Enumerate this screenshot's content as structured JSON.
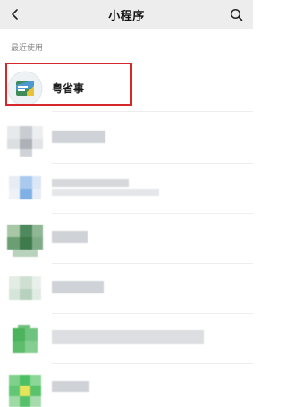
{
  "header": {
    "title": "小程序",
    "back_icon": "chevron-left-icon",
    "search_icon": "search-icon"
  },
  "recent": {
    "section_label": "最近使用",
    "items": [
      {
        "label": "粤省事",
        "icon": "yue-sheng-shi-logo"
      },
      {
        "label": "",
        "icon": "pixelated-app-icon"
      },
      {
        "label": "",
        "icon": "pixelated-app-icon"
      },
      {
        "label": "",
        "icon": "pixelated-app-icon"
      },
      {
        "label": "",
        "icon": "pixelated-app-icon"
      },
      {
        "label": "",
        "icon": "pixelated-app-icon"
      },
      {
        "label": "",
        "icon": "pixelated-app-icon"
      }
    ]
  },
  "colors": {
    "highlight": "#d6282a",
    "header_bg": "#ededed"
  }
}
